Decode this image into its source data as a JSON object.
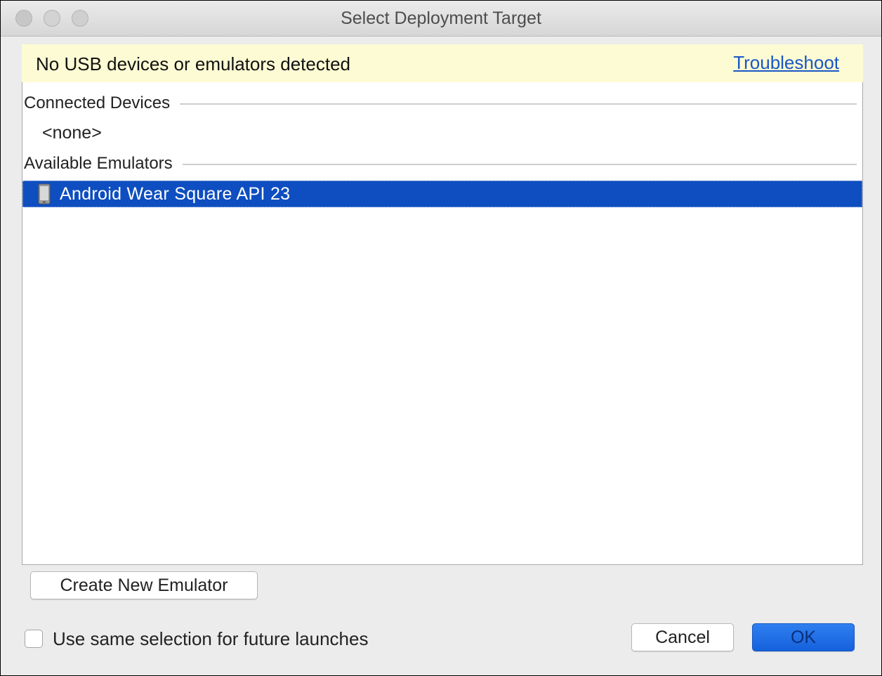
{
  "window": {
    "title": "Select Deployment Target"
  },
  "banner": {
    "message": "No USB devices or emulators detected",
    "link_label": "Troubleshoot",
    "background_color": "#fdfbd3"
  },
  "list": {
    "connected_header": "Connected Devices",
    "connected_empty": "<none>",
    "emulators_header": "Available Emulators",
    "emulators": [
      {
        "label": "Android Wear Square API 23",
        "icon": "device-phone-icon",
        "selected": true
      }
    ],
    "selection_color": "#0e4ec0"
  },
  "buttons": {
    "create_label": "Create New Emulator",
    "cancel_label": "Cancel",
    "ok_label": "OK",
    "ok_color": "#1a6ae6"
  },
  "options": {
    "same_selection_label": "Use same selection for future launches",
    "same_selection_checked": false
  }
}
